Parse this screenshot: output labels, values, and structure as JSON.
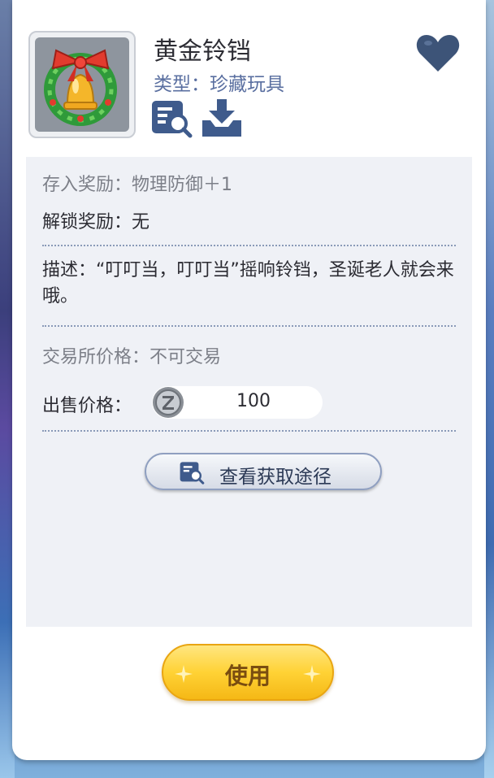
{
  "item": {
    "title": "黄金铃铛",
    "type_label": "类型：",
    "type_value": "珍藏玩具"
  },
  "icons": {
    "detail": "magnifier-document-icon",
    "download": "download-tray-icon",
    "favorite": "heart-icon",
    "item_image": "golden-bell-wreath-icon",
    "coin": "zeny-coin-icon"
  },
  "info": {
    "deposit_reward": "存入奖励：物理防御＋1",
    "unlock_reward": "解锁奖励：无",
    "description": "描述：“叮叮当，叮叮当”摇响铃铛，圣诞老人就会来哦。",
    "exchange_price": "交易所价格：不可交易",
    "sell_price_label": "出售价格：",
    "sell_price_value": "100"
  },
  "buttons": {
    "view_source": "查看获取途径",
    "use": "使用"
  },
  "colors": {
    "accent_blue": "#3f5b8c",
    "use_button": "#ffd235"
  }
}
